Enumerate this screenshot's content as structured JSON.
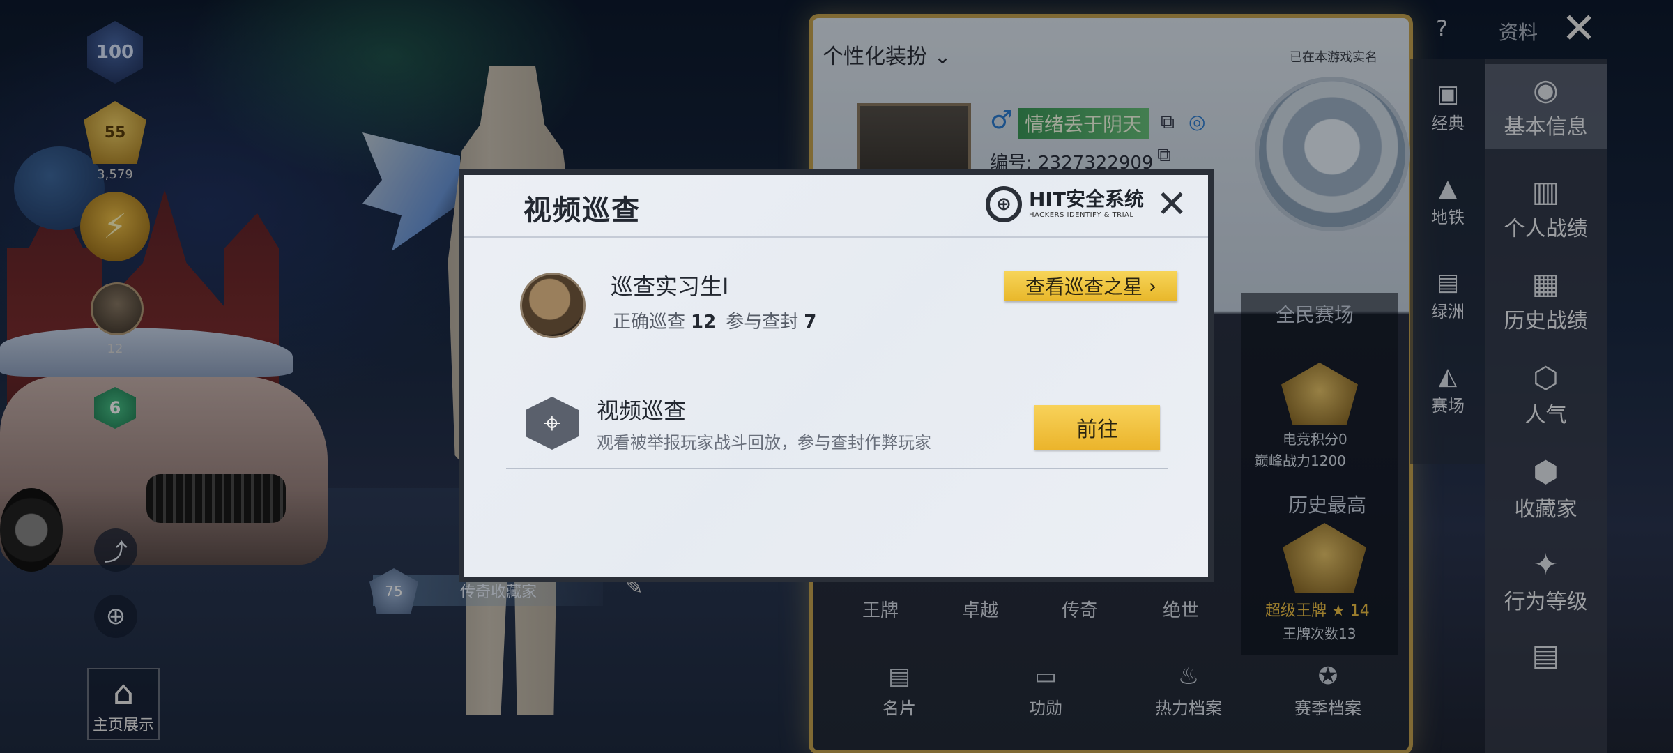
{
  "left_hud": {
    "rank_badge_text": "100",
    "gold_badge_text": "55",
    "gold_count": "3,579",
    "gun_count": "12",
    "green_badge_text": "6",
    "home_label": "主页展示",
    "collector_level": "75",
    "collector_label": "传奇收藏家"
  },
  "profile": {
    "custom_label": "个性化装扮",
    "realname_label": "已在本游戏实名",
    "player_name": "情绪丢于阴天",
    "player_id": "编号: 2327322909",
    "quanmin_label": "全民赛场",
    "esports_points": "电竞积分0",
    "peak_power": "巅峰战力1200",
    "history_high_label": "历史最高",
    "super_ace_label": "超级王牌",
    "super_ace_stars": "14",
    "ace_count": "王牌次数13",
    "tiers": [
      "王牌",
      "卓越",
      "传奇",
      "绝世"
    ],
    "bottom_tabs": [
      {
        "label": "名片",
        "icon": "id-card-icon"
      },
      {
        "label": "功勋",
        "icon": "medal-icon"
      },
      {
        "label": "热力档案",
        "icon": "fire-icon"
      },
      {
        "label": "赛季档案",
        "icon": "season-icon"
      }
    ]
  },
  "mid_sidebar": [
    {
      "label": "经典",
      "icon": "classic-icon"
    },
    {
      "label": "地铁",
      "icon": "metro-icon"
    },
    {
      "label": "绿洲",
      "icon": "oasis-icon"
    },
    {
      "label": "赛场",
      "icon": "arena-icon"
    }
  ],
  "right_sidebar": [
    {
      "label": "基本信息",
      "icon": "user-info-icon"
    },
    {
      "label": "个人战绩",
      "icon": "stats-icon"
    },
    {
      "label": "历史战绩",
      "icon": "history-icon"
    },
    {
      "label": "人气",
      "icon": "popularity-icon"
    },
    {
      "label": "收藏家",
      "icon": "collector-icon"
    },
    {
      "label": "行为等级",
      "icon": "behavior-icon"
    }
  ],
  "top_bar": {
    "data_label": "资料"
  },
  "dialog": {
    "title": "视频巡查",
    "logo_main": "HIT安全系统",
    "logo_sub": "HACKERS IDENTIFY & TRIAL",
    "rank_name": "巡查实习生I",
    "correct_label": "正确巡查",
    "correct_value": "12",
    "ban_label": "参与查封",
    "ban_value": "7",
    "star_button": "查看巡查之星",
    "review_title": "视频巡查",
    "review_desc": "观看被举报玩家战斗回放，参与查封作弊玩家",
    "go_button": "前往"
  },
  "colors": {
    "accent_gold": "#f2c94c",
    "dialog_bg": "#eceff4",
    "frame_gold": "#c5a451"
  }
}
